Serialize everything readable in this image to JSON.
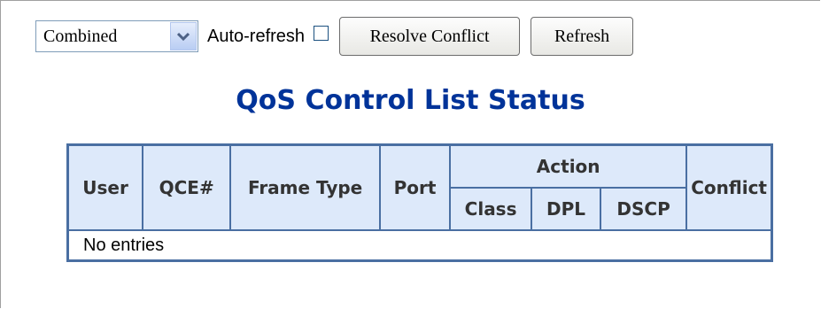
{
  "toolbar": {
    "select_value": "Combined",
    "auto_refresh_label": "Auto-refresh",
    "auto_refresh_checked": false,
    "resolve_label": "Resolve Conflict",
    "refresh_label": "Refresh"
  },
  "page_title": "QoS Control List Status",
  "table": {
    "headers": {
      "user": "User",
      "qce": "QCE#",
      "frame_type": "Frame Type",
      "port": "Port",
      "action": "Action",
      "class": "Class",
      "dpl": "DPL",
      "dscp": "DSCP",
      "conflict": "Conflict"
    },
    "empty_message": "No entries"
  },
  "colors": {
    "title": "#003399",
    "header_bg": "#dde9fa",
    "border": "#4a6fa2"
  }
}
